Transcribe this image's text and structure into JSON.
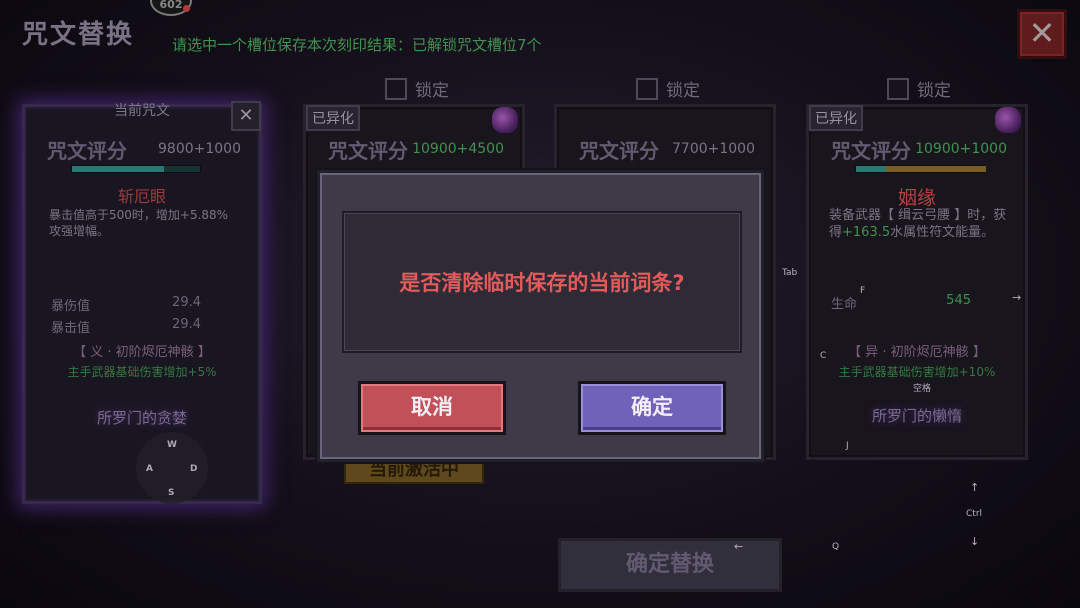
{
  "header": {
    "title": "咒文替换",
    "hint": "请选中一个槽位保存本次刻印结果：已解锁咒文槽位7个",
    "badge": "602",
    "close_icon": "close-icon"
  },
  "locks": [
    {
      "label": "锁定"
    },
    {
      "label": "锁定"
    },
    {
      "label": "锁定"
    }
  ],
  "cards": {
    "current": {
      "header": "当前咒文",
      "score_label": "咒文评分",
      "score_value": "9800+1000",
      "name": "斩厄眼",
      "desc": "暴击值高于500时，增加+5.88%攻强增幅。",
      "stats": [
        {
          "label": "暴伤值",
          "value": "29.4"
        },
        {
          "label": "暴击值",
          "value": "29.4"
        }
      ],
      "set_name": "【 义 · 初阶烬厄神骸 】",
      "set_bonus": "主手武器基础伤害增加+5%",
      "footer_name": "所罗门的贪婪"
    },
    "slot2": {
      "tag": "已异化",
      "score_label": "咒文评分",
      "score_value": "10900+4500"
    },
    "slot3": {
      "score_label": "咒文评分",
      "score_value": "7700+1000"
    },
    "slot4": {
      "tag": "已异化",
      "score_label": "咒文评分",
      "score_value": "10900+1000",
      "name": "姻缘",
      "desc_pre": "装备武器【 缉云弓腰 】时，获得",
      "desc_value": "+163.5",
      "desc_post": "水属性符文能量。",
      "stat_label": "生命",
      "stat_value": "545",
      "set_name": "【 异 · 初阶烬厄神骸 】",
      "set_bonus": "主手武器基础伤害增加+10%",
      "footer_name": "所罗门的懒惰"
    }
  },
  "below_badge": "当前激活中",
  "confirm_replace": "确定替换",
  "wasd": {
    "w": "W",
    "a": "A",
    "s": "S",
    "d": "D"
  },
  "keys": {
    "tab": "Tab",
    "f": "F",
    "c": "C",
    "space": "空格",
    "j": "J",
    "up": "↑",
    "ctrl": "Ctrl",
    "down": "↓",
    "left": "←",
    "right": "→",
    "q": "Q"
  },
  "modal": {
    "message": "是否清除临时保存的当前词条?",
    "cancel_label": "取消",
    "confirm_label": "确定"
  },
  "colors": {
    "accent_red": "#e25a5a",
    "cancel_button": "#c25058",
    "confirm_button": "#7062b8",
    "hint_green": "#4aa55a"
  }
}
